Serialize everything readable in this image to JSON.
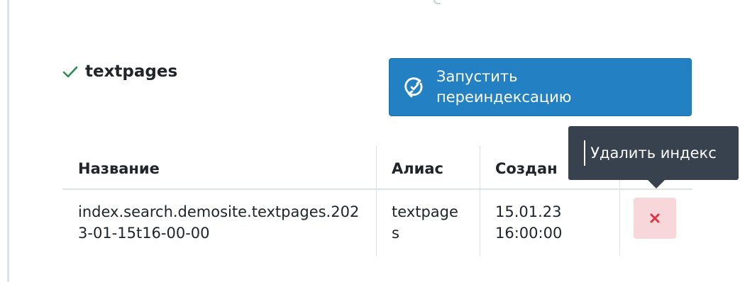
{
  "index": {
    "name": "textpages",
    "status_icon": "check-icon",
    "status_color": "#2e8b57"
  },
  "reindex_button": {
    "label": "Запустить переиндексацию",
    "icon": "refresh-check-icon",
    "color": "#2280c3"
  },
  "table": {
    "headers": [
      "Название",
      "Алиас",
      "Создан",
      ""
    ],
    "rows": [
      {
        "name": "index.search.demosite.textpages.2023-01-15t16-00-00",
        "alias": "textpages",
        "created": "15.01.23 16:00:00",
        "delete_icon": "close-icon"
      }
    ]
  },
  "tooltip": {
    "text": "Удалить индекс"
  },
  "colors": {
    "delete_bg": "#f8d7da",
    "delete_icon": "#dc3545",
    "tooltip_bg": "#37424e"
  }
}
